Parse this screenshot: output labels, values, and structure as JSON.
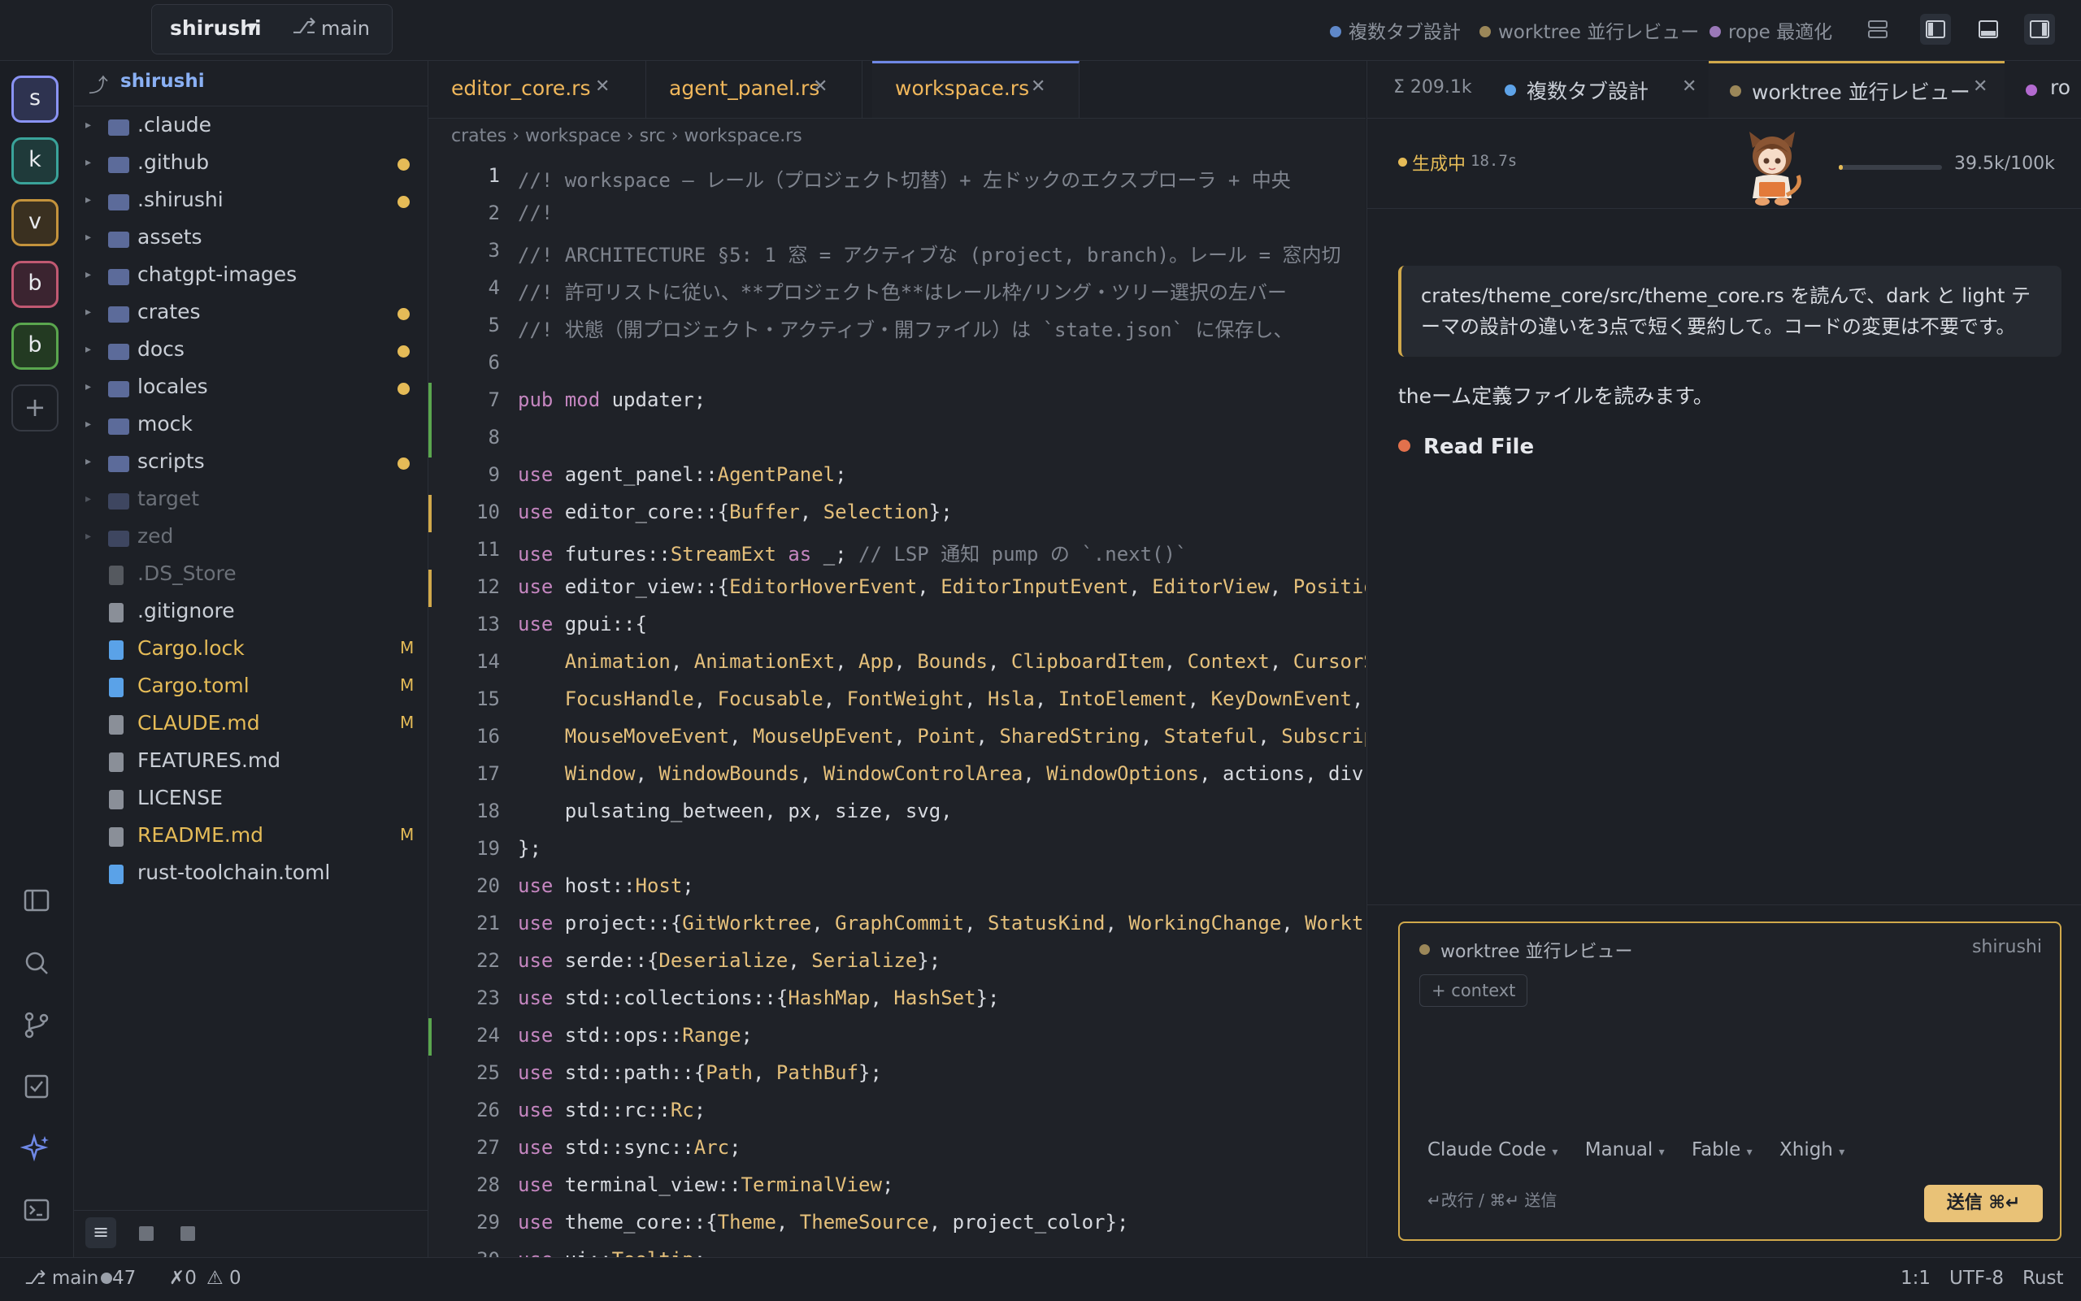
{
  "titlebar": {
    "project": "shirushi",
    "branch": "main",
    "sessions": [
      {
        "label": "複数タブ設計",
        "color": "#5f88c9"
      },
      {
        "label": "worktree 並行レビュー",
        "color": "#9b8759"
      },
      {
        "label": "rope 最適化",
        "color": "#9a78b8"
      }
    ]
  },
  "rail": {
    "projects": [
      {
        "letter": "s",
        "color": "#8a93f4"
      },
      {
        "letter": "k",
        "color": "#3aa39a"
      },
      {
        "letter": "v",
        "color": "#c4933c"
      },
      {
        "letter": "b",
        "color": "#c15972"
      },
      {
        "letter": "b",
        "color": "#5aa64e"
      }
    ],
    "add": "+"
  },
  "explorer": {
    "root": "shirushi",
    "items": [
      {
        "name": ".claude",
        "type": "folder",
        "dot": false,
        "mark": "",
        "dim": false
      },
      {
        "name": ".github",
        "type": "folder",
        "dot": true,
        "mark": "",
        "dim": false
      },
      {
        "name": ".shirushi",
        "type": "folder",
        "dot": true,
        "mark": "",
        "dim": false
      },
      {
        "name": "assets",
        "type": "folder",
        "dot": false,
        "mark": "",
        "dim": false
      },
      {
        "name": "chatgpt-images",
        "type": "folder",
        "dot": false,
        "mark": "",
        "dim": false
      },
      {
        "name": "crates",
        "type": "folder",
        "dot": true,
        "mark": "",
        "dim": false
      },
      {
        "name": "docs",
        "type": "folder",
        "dot": true,
        "mark": "",
        "dim": false
      },
      {
        "name": "locales",
        "type": "folder",
        "dot": true,
        "mark": "",
        "dim": false
      },
      {
        "name": "mock",
        "type": "folder",
        "dot": false,
        "mark": "",
        "dim": false
      },
      {
        "name": "scripts",
        "type": "folder",
        "dot": true,
        "mark": "",
        "dim": false
      },
      {
        "name": "target",
        "type": "folder",
        "dot": false,
        "mark": "",
        "dim": true
      },
      {
        "name": "zed",
        "type": "folder",
        "dot": false,
        "mark": "",
        "dim": true
      },
      {
        "name": ".DS_Store",
        "type": "file",
        "dot": false,
        "mark": "",
        "dim": true
      },
      {
        "name": ".gitignore",
        "type": "file",
        "dot": false,
        "mark": "",
        "dim": false
      },
      {
        "name": "Cargo.lock",
        "type": "file-blue",
        "dot": false,
        "mark": "M",
        "dim": false,
        "modified": true
      },
      {
        "name": "Cargo.toml",
        "type": "file-blue",
        "dot": false,
        "mark": "M",
        "dim": false,
        "modified": true
      },
      {
        "name": "CLAUDE.md",
        "type": "file",
        "dot": false,
        "mark": "M",
        "dim": false,
        "modified": true
      },
      {
        "name": "FEATURES.md",
        "type": "file",
        "dot": false,
        "mark": "",
        "dim": false
      },
      {
        "name": "LICENSE",
        "type": "file",
        "dot": false,
        "mark": "",
        "dim": false
      },
      {
        "name": "README.md",
        "type": "file",
        "dot": false,
        "mark": "M",
        "dim": false,
        "modified": true
      },
      {
        "name": "rust-toolchain.toml",
        "type": "file-blue",
        "dot": false,
        "mark": "",
        "dim": false
      }
    ]
  },
  "editor": {
    "tabs": [
      {
        "label": "editor_core.rs",
        "active": false
      },
      {
        "label": "agent_panel.rs",
        "active": false
      },
      {
        "label": "workspace.rs",
        "active": true
      }
    ],
    "breadcrumb": "crates › workspace › src › workspace.rs",
    "lines": [
      {
        "n": "1",
        "g": "",
        "p": [
          [
            "cm",
            "//! workspace — レール（プロジェクト切替）+ 左ドックのエクスプローラ + 中央"
          ]
        ]
      },
      {
        "n": "2",
        "g": "",
        "p": [
          [
            "cm",
            "//!"
          ]
        ]
      },
      {
        "n": "3",
        "g": "",
        "p": [
          [
            "cm",
            "//! ARCHITECTURE §5: 1 窓 = アクティブな (project, branch)。レール = 窓内切"
          ]
        ]
      },
      {
        "n": "4",
        "g": "",
        "p": [
          [
            "cm",
            "//! 許可リストに従い、**プロジェクト色**はレール枠/リング・ツリー選択の左バー"
          ]
        ]
      },
      {
        "n": "5",
        "g": "",
        "p": [
          [
            "cm",
            "//! 状態（開プロジェクト・アクティブ・開ファイル）は `state.json` に保存し、"
          ]
        ]
      },
      {
        "n": "6",
        "g": "",
        "p": []
      },
      {
        "n": "7",
        "g": "added",
        "p": [
          [
            "kw",
            "pub mod "
          ],
          [
            "pl",
            "updater;"
          ]
        ]
      },
      {
        "n": "8",
        "g": "added",
        "p": []
      },
      {
        "n": "9",
        "g": "",
        "p": [
          [
            "kw",
            "use "
          ],
          [
            "pl",
            "agent_panel::"
          ],
          [
            "ty",
            "AgentPanel"
          ],
          [
            "pl",
            ";"
          ]
        ]
      },
      {
        "n": "10",
        "g": "modified",
        "p": [
          [
            "kw",
            "use "
          ],
          [
            "pl",
            "editor_core::{"
          ],
          [
            "ty",
            "Buffer"
          ],
          [
            "pl",
            ", "
          ],
          [
            "ty",
            "Selection"
          ],
          [
            "pl",
            "};"
          ]
        ]
      },
      {
        "n": "11",
        "g": "",
        "p": [
          [
            "kw",
            "use "
          ],
          [
            "pl",
            "futures::"
          ],
          [
            "ty",
            "StreamExt "
          ],
          [
            "kw",
            "as "
          ],
          [
            "pl",
            "_; "
          ],
          [
            "cm",
            "// LSP 通知 pump の `.next()`"
          ]
        ]
      },
      {
        "n": "12",
        "g": "modified",
        "p": [
          [
            "kw",
            "use "
          ],
          [
            "pl",
            "editor_view::{"
          ],
          [
            "ty",
            "EditorHoverEvent"
          ],
          [
            "pl",
            ", "
          ],
          [
            "ty",
            "EditorInputEvent"
          ],
          [
            "pl",
            ", "
          ],
          [
            "ty",
            "EditorView"
          ],
          [
            "pl",
            ", "
          ],
          [
            "ty",
            "PositionSn"
          ]
        ]
      },
      {
        "n": "13",
        "g": "",
        "p": [
          [
            "kw",
            "use "
          ],
          [
            "pl",
            "gpui::{"
          ]
        ]
      },
      {
        "n": "14",
        "g": "",
        "p": [
          [
            "pl",
            "    "
          ],
          [
            "ty",
            "Animation"
          ],
          [
            "pl",
            ", "
          ],
          [
            "ty",
            "AnimationExt"
          ],
          [
            "pl",
            ", "
          ],
          [
            "ty",
            "App"
          ],
          [
            "pl",
            ", "
          ],
          [
            "ty",
            "Bounds"
          ],
          [
            "pl",
            ", "
          ],
          [
            "ty",
            "ClipboardItem"
          ],
          [
            "pl",
            ", "
          ],
          [
            "ty",
            "Context"
          ],
          [
            "pl",
            ", "
          ],
          [
            "ty",
            "CursorStyl"
          ]
        ]
      },
      {
        "n": "15",
        "g": "",
        "p": [
          [
            "pl",
            "    "
          ],
          [
            "ty",
            "FocusHandle"
          ],
          [
            "pl",
            ", "
          ],
          [
            "ty",
            "Focusable"
          ],
          [
            "pl",
            ", "
          ],
          [
            "ty",
            "FontWeight"
          ],
          [
            "pl",
            ", "
          ],
          [
            "ty",
            "Hsla"
          ],
          [
            "pl",
            ", "
          ],
          [
            "ty",
            "IntoElement"
          ],
          [
            "pl",
            ", "
          ],
          [
            "ty",
            "KeyDownEvent"
          ],
          [
            "pl",
            ", "
          ],
          [
            "ty",
            "Mou"
          ]
        ]
      },
      {
        "n": "16",
        "g": "",
        "p": [
          [
            "pl",
            "    "
          ],
          [
            "ty",
            "MouseMoveEvent"
          ],
          [
            "pl",
            ", "
          ],
          [
            "ty",
            "MouseUpEvent"
          ],
          [
            "pl",
            ", "
          ],
          [
            "ty",
            "Point"
          ],
          [
            "pl",
            ", "
          ],
          [
            "ty",
            "SharedString"
          ],
          [
            "pl",
            ", "
          ],
          [
            "ty",
            "Stateful"
          ],
          [
            "pl",
            ", "
          ],
          [
            "ty",
            "Subscriptio"
          ]
        ]
      },
      {
        "n": "17",
        "g": "",
        "p": [
          [
            "pl",
            "    "
          ],
          [
            "ty",
            "Window"
          ],
          [
            "pl",
            ", "
          ],
          [
            "ty",
            "WindowBounds"
          ],
          [
            "pl",
            ", "
          ],
          [
            "ty",
            "WindowControlArea"
          ],
          [
            "pl",
            ", "
          ],
          [
            "ty",
            "WindowOptions"
          ],
          [
            "pl",
            ", actions, div, po"
          ]
        ]
      },
      {
        "n": "18",
        "g": "",
        "p": [
          [
            "pl",
            "    pulsating_between, px, size, svg,"
          ]
        ]
      },
      {
        "n": "19",
        "g": "",
        "p": [
          [
            "pl",
            "};"
          ]
        ]
      },
      {
        "n": "20",
        "g": "",
        "p": [
          [
            "kw",
            "use "
          ],
          [
            "pl",
            "host::"
          ],
          [
            "ty",
            "Host"
          ],
          [
            "pl",
            ";"
          ]
        ]
      },
      {
        "n": "21",
        "g": "",
        "p": [
          [
            "kw",
            "use "
          ],
          [
            "pl",
            "project::{"
          ],
          [
            "ty",
            "GitWorktree"
          ],
          [
            "pl",
            ", "
          ],
          [
            "ty",
            "GraphCommit"
          ],
          [
            "pl",
            ", "
          ],
          [
            "ty",
            "StatusKind"
          ],
          [
            "pl",
            ", "
          ],
          [
            "ty",
            "WorkingChange"
          ],
          [
            "pl",
            ", "
          ],
          [
            "ty",
            "Worktree"
          ],
          [
            "pl",
            "}"
          ]
        ]
      },
      {
        "n": "22",
        "g": "",
        "p": [
          [
            "kw",
            "use "
          ],
          [
            "pl",
            "serde::{"
          ],
          [
            "ty",
            "Deserialize"
          ],
          [
            "pl",
            ", "
          ],
          [
            "ty",
            "Serialize"
          ],
          [
            "pl",
            "};"
          ]
        ]
      },
      {
        "n": "23",
        "g": "",
        "p": [
          [
            "kw",
            "use "
          ],
          [
            "pl",
            "std::collections::{"
          ],
          [
            "ty",
            "HashMap"
          ],
          [
            "pl",
            ", "
          ],
          [
            "ty",
            "HashSet"
          ],
          [
            "pl",
            "};"
          ]
        ]
      },
      {
        "n": "24",
        "g": "added",
        "p": [
          [
            "kw",
            "use "
          ],
          [
            "pl",
            "std::ops::"
          ],
          [
            "ty",
            "Range"
          ],
          [
            "pl",
            ";"
          ]
        ]
      },
      {
        "n": "25",
        "g": "",
        "p": [
          [
            "kw",
            "use "
          ],
          [
            "pl",
            "std::path::{"
          ],
          [
            "ty",
            "Path"
          ],
          [
            "pl",
            ", "
          ],
          [
            "ty",
            "PathBuf"
          ],
          [
            "pl",
            "};"
          ]
        ]
      },
      {
        "n": "26",
        "g": "",
        "p": [
          [
            "kw",
            "use "
          ],
          [
            "pl",
            "std::rc::"
          ],
          [
            "ty",
            "Rc"
          ],
          [
            "pl",
            ";"
          ]
        ]
      },
      {
        "n": "27",
        "g": "",
        "p": [
          [
            "kw",
            "use "
          ],
          [
            "pl",
            "std::sync::"
          ],
          [
            "ty",
            "Arc"
          ],
          [
            "pl",
            ";"
          ]
        ]
      },
      {
        "n": "28",
        "g": "",
        "p": [
          [
            "kw",
            "use "
          ],
          [
            "pl",
            "terminal_view::"
          ],
          [
            "ty",
            "TerminalView"
          ],
          [
            "pl",
            ";"
          ]
        ]
      },
      {
        "n": "29",
        "g": "",
        "p": [
          [
            "kw",
            "use "
          ],
          [
            "pl",
            "theme_core::{"
          ],
          [
            "ty",
            "Theme"
          ],
          [
            "pl",
            ", "
          ],
          [
            "ty",
            "ThemeSource"
          ],
          [
            "pl",
            ", project_color};"
          ]
        ]
      },
      {
        "n": "30",
        "g": "",
        "p": [
          [
            "kw",
            "use "
          ],
          [
            "pl",
            "ui::"
          ],
          [
            "ty",
            "Tooltip"
          ],
          [
            "pl",
            ";"
          ]
        ]
      }
    ]
  },
  "agent": {
    "tokens": "Σ 209.1k",
    "tabs": [
      {
        "label": "複数タブ設計",
        "color": "#5ea3e8",
        "active": false
      },
      {
        "label": "worktree 並行レビュー",
        "color": "#9b8759",
        "active": true
      },
      {
        "label": "ro",
        "color": "#b36ad0",
        "active": false
      }
    ],
    "status": "生成中",
    "elapsed": "18.7s",
    "context": "39.5k/100k",
    "context_fraction": 0.04,
    "user_message": "crates/theme_core/src/theme_core.rs を読んで、dark と light テーマの設計の違いを3点で短く要約して。コードの変更は不要です。",
    "reply": "theーム定義ファイルを読みます。",
    "tool": "Read File",
    "composer": {
      "session": "worktree 並行レビュー",
      "project": "shirushi",
      "context_btn": "+ context",
      "selectors": [
        "Claude Code",
        "Manual",
        "Fable",
        "Xhigh"
      ],
      "hint": "↵改行 / ⌘↵ 送信",
      "send": "送信 ⌘↵"
    }
  },
  "statusbar": {
    "branch": "main",
    "changes": "47",
    "errors": "0",
    "warnings": "0",
    "position": "1:1",
    "encoding": "UTF-8",
    "language": "Rust"
  }
}
